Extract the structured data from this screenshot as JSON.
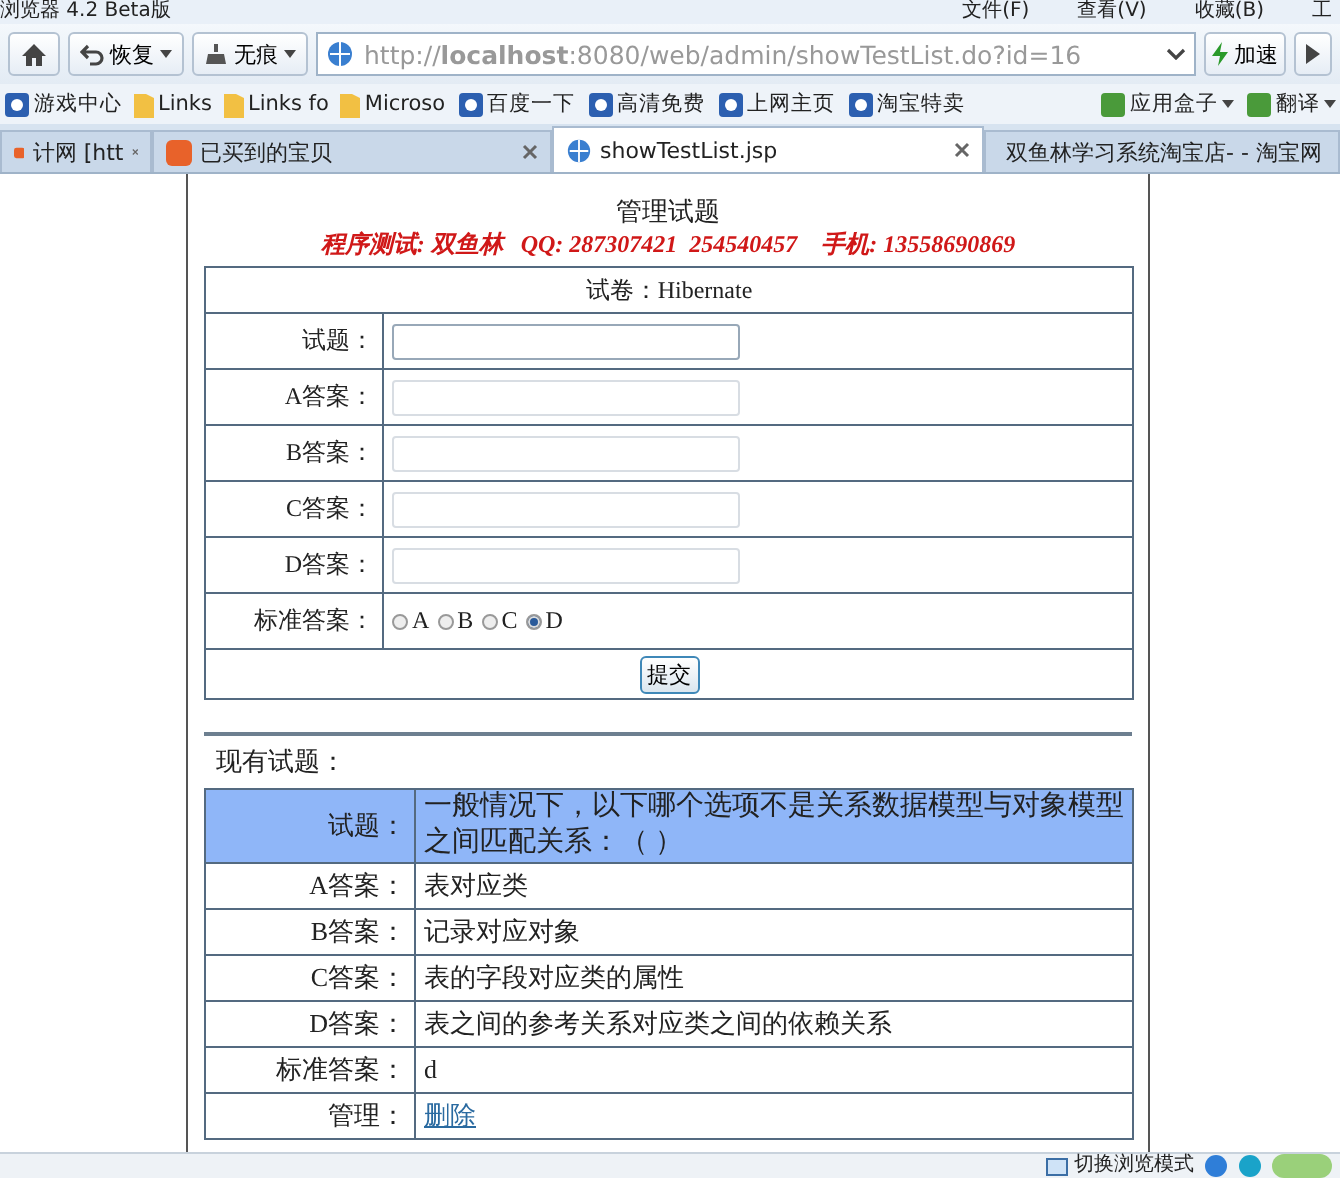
{
  "browser": {
    "title": "浏览器 4.2 Beta版",
    "menu": [
      "文件(F)",
      "查看(V)",
      "收藏(B)",
      "工"
    ],
    "toolbar": {
      "restore": "恢复",
      "private": "无痕"
    },
    "address": "http://**localhost**:8080/web/admin/showTestList.do?id=16",
    "speed": "加速",
    "bookmarks": [
      {
        "label": "游戏中心",
        "kind": "site"
      },
      {
        "label": "Links",
        "kind": "folder"
      },
      {
        "label": "Links fo",
        "kind": "folder"
      },
      {
        "label": "Microso",
        "kind": "folder"
      },
      {
        "label": "百度一下",
        "kind": "site"
      },
      {
        "label": "高清免费",
        "kind": "site"
      },
      {
        "label": "上网主页",
        "kind": "site"
      },
      {
        "label": "淘宝特卖",
        "kind": "site"
      }
    ],
    "bookmarks_right": [
      {
        "label": "应用盒子"
      },
      {
        "label": "翻译"
      }
    ],
    "tabs": [
      {
        "label": "计网 [htt",
        "selected": false
      },
      {
        "label": "已买到的宝贝",
        "selected": false
      },
      {
        "label": "showTestList.jsp",
        "selected": true
      },
      {
        "label": "双鱼林学习系统淘宝店- - 淘宝网",
        "selected": false
      }
    ]
  },
  "page": {
    "heading": "管理试题",
    "notice": "程序测试: 双鱼林   QQ: 287307421  254540457    手机: 13558690869",
    "form": {
      "caption": "试卷：Hibernate",
      "fields": [
        {
          "label": "试题：",
          "focused": true
        },
        {
          "label": "A答案：",
          "focused": false
        },
        {
          "label": "B答案：",
          "focused": false
        },
        {
          "label": "C答案：",
          "focused": false
        },
        {
          "label": "D答案：",
          "focused": false
        }
      ],
      "answer": {
        "label": "标准答案：",
        "options": [
          {
            "label": "A",
            "selected": false
          },
          {
            "label": "B",
            "selected": false
          },
          {
            "label": "C",
            "selected": false
          },
          {
            "label": "D",
            "selected": true
          }
        ]
      },
      "submit": "提交"
    },
    "list_heading": "现有试题：",
    "questions": [
      {
        "label": "试题：",
        "value": "一般情况下，以下哪个选项不是关系数据模型与对象模型之间匹配关系：（    ）",
        "kind": "header"
      },
      {
        "label": "A答案：",
        "value": "表对应类",
        "kind": "text"
      },
      {
        "label": "B答案：",
        "value": "记录对应对象",
        "kind": "text"
      },
      {
        "label": "C答案：",
        "value": "表的字段对应类的属性",
        "kind": "text"
      },
      {
        "label": "D答案：",
        "value": "表之间的参考关系对应类之间的依赖关系",
        "kind": "text"
      },
      {
        "label": "标准答案：",
        "value": "d",
        "kind": "text"
      },
      {
        "label": "管理：",
        "value": "删除",
        "kind": "link"
      }
    ]
  },
  "status_bar": {
    "mode": "切换浏览模式"
  }
}
